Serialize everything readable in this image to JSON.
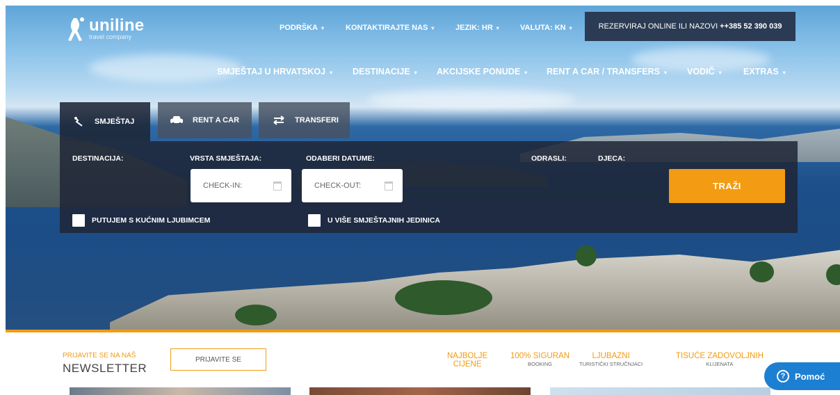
{
  "logo": {
    "word": "uniline",
    "sub": "travel company"
  },
  "topnav": [
    {
      "label": "PODRŠKA"
    },
    {
      "label": "KONTAKTIRAJTE NAS"
    },
    {
      "label": "JEZIK: HR"
    },
    {
      "label": "VALUTA: KN"
    }
  ],
  "booking": {
    "text": "REZERVIRAJ ONLINE ILI NAZOVI",
    "phone": "++385 52 390 039"
  },
  "mainnav": [
    {
      "label": "SMJEŠTAJ U HRVATSKOJ"
    },
    {
      "label": "DESTINACIJE"
    },
    {
      "label": "AKCIJSKE PONUDE"
    },
    {
      "label": "RENT A CAR / TRANSFERS"
    },
    {
      "label": "VODIČ"
    },
    {
      "label": "EXTRAS"
    }
  ],
  "tabs": [
    {
      "label": "SMJEŠTAJ",
      "icon": "bed-icon"
    },
    {
      "label": "RENT A CAR",
      "icon": "car-icon"
    },
    {
      "label": "TRANSFERI",
      "icon": "arrows-icon"
    }
  ],
  "search": {
    "labels": {
      "destination": "DESTINACIJA:",
      "type": "VRSTA SMJEŠTAJA:",
      "dates": "ODABERI DATUME:",
      "adults": "ODRASLI:",
      "children": "DJECA:"
    },
    "checkin": "CHECK-IN:",
    "checkout": "CHECK-OUT:",
    "button": "TRAŽI",
    "pet": "PUTUJEM S KUĆNIM LJUBIMCEM",
    "multi": "U VIŠE SMJEŠTAJNIH JEDINICA"
  },
  "newsletter": {
    "small": "PRIJAVITE SE NA NAŠ",
    "big": "NEWSLETTER",
    "button": "PRIJAVITE SE"
  },
  "features": [
    {
      "title": "NAJBOLJE",
      "sub": "CIJENE"
    },
    {
      "title": "100% SIGURAN",
      "sub": "BOOKING"
    },
    {
      "title": "LJUBAZNI",
      "sub": "TURISTIČKI STRUČNJACI"
    },
    {
      "title": "TISUĆE ZADOVOLJNIH",
      "sub": "KLIJENATA"
    }
  ],
  "help": {
    "label": "Pomoć"
  },
  "colors": {
    "accent": "#f29b13",
    "panel": "#1e2636",
    "help": "#1d7fd1"
  }
}
